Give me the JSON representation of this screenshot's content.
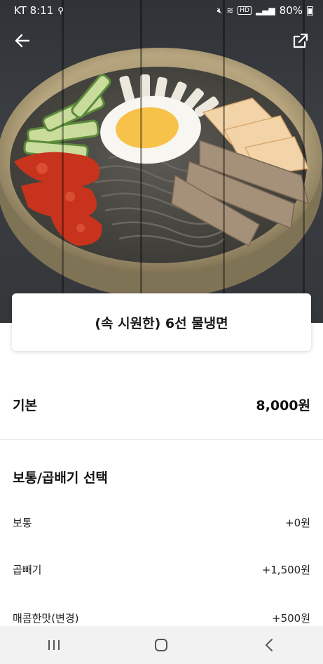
{
  "status_bar": {
    "carrier_time": "KT 8:11",
    "battery": "80%"
  },
  "hero": {
    "image_icon": "cold-noodle-photo"
  },
  "nav": {
    "back_icon": "back-arrow-icon",
    "share_icon": "share-icon"
  },
  "product": {
    "title": "(속 시원한) 6선 물냉면"
  },
  "base": {
    "label": "기본",
    "price": "8,000원"
  },
  "option_group": {
    "title": "보통/곱배기 선택",
    "options": [
      {
        "label": "보통",
        "price": "+0원"
      },
      {
        "label": "곱빼기",
        "price": "+1,500원"
      },
      {
        "label": "매콤한맛(변경)",
        "price": "+500원"
      }
    ]
  },
  "system_nav": {
    "recent_icon": "recent-apps-icon",
    "home_icon": "home-icon",
    "back_icon": "system-back-icon"
  },
  "colors": {
    "bowl_brass": "#b7a27a",
    "egg_yolk": "#f7c24a",
    "kimchi_red": "#c8331e"
  }
}
